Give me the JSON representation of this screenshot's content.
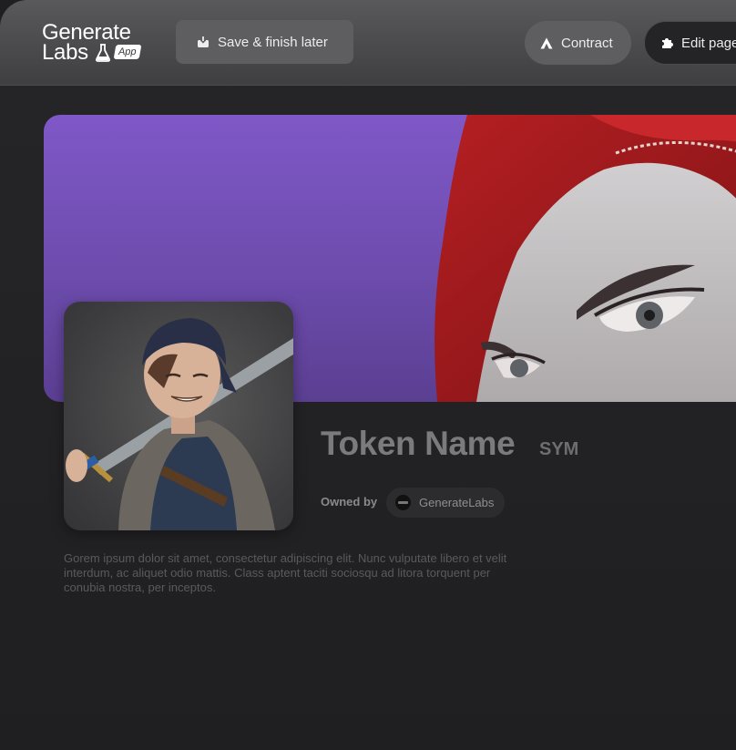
{
  "header": {
    "logo": {
      "line1": "Generate",
      "line2": "Labs",
      "badge": "App"
    },
    "save_button": {
      "label": "Save & finish later",
      "icon": "download-box-icon"
    },
    "contract_button": {
      "label": "Contract",
      "icon": "triangle-icon"
    },
    "edit_button": {
      "label": "Edit page",
      "icon": "puzzle-icon"
    }
  },
  "token": {
    "name": "Token Name",
    "symbol": "SYM",
    "owned_by_label": "Owned by",
    "owner": "GenerateLabs",
    "description": "Gorem ipsum dolor sit amet, consectetur adipiscing elit. Nunc vulputate libero et velit interdum, ac aliquet odio mattis. Class aptent taciti sociosqu ad litora torquent per conubia nostra, per inceptos."
  },
  "colors": {
    "banner_purple": "#7f58c7",
    "topbar": "#4d4d4f",
    "background": "#1f1f21"
  }
}
